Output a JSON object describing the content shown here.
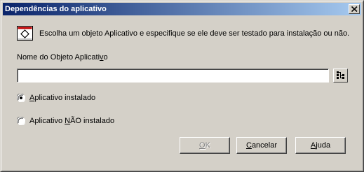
{
  "window": {
    "title": "Dependências do aplicativo"
  },
  "info": {
    "icon": "application-object-icon",
    "text": "Escolha um objeto Aplicativo e especifique se ele deve ser testado para instalação ou não."
  },
  "field": {
    "label_prefix": "Nome do Objeto Aplicati",
    "label_accel": "v",
    "label_suffix": "o",
    "value": "",
    "browse_icon": "object-browser-icon"
  },
  "options": {
    "installed": {
      "label_prefix": "",
      "label_accel": "A",
      "label_suffix": "plicativo instalado",
      "checked": true
    },
    "not_installed": {
      "label_prefix": "Aplicativo ",
      "label_accel": "N",
      "label_suffix": "ÃO instalado",
      "checked": false
    }
  },
  "buttons": {
    "ok": {
      "accel": "O",
      "rest": "K",
      "enabled": false
    },
    "cancel": {
      "accel": "C",
      "rest": "ancelar",
      "enabled": true
    },
    "help": {
      "accel": "A",
      "rest": "juda",
      "enabled": true
    }
  }
}
